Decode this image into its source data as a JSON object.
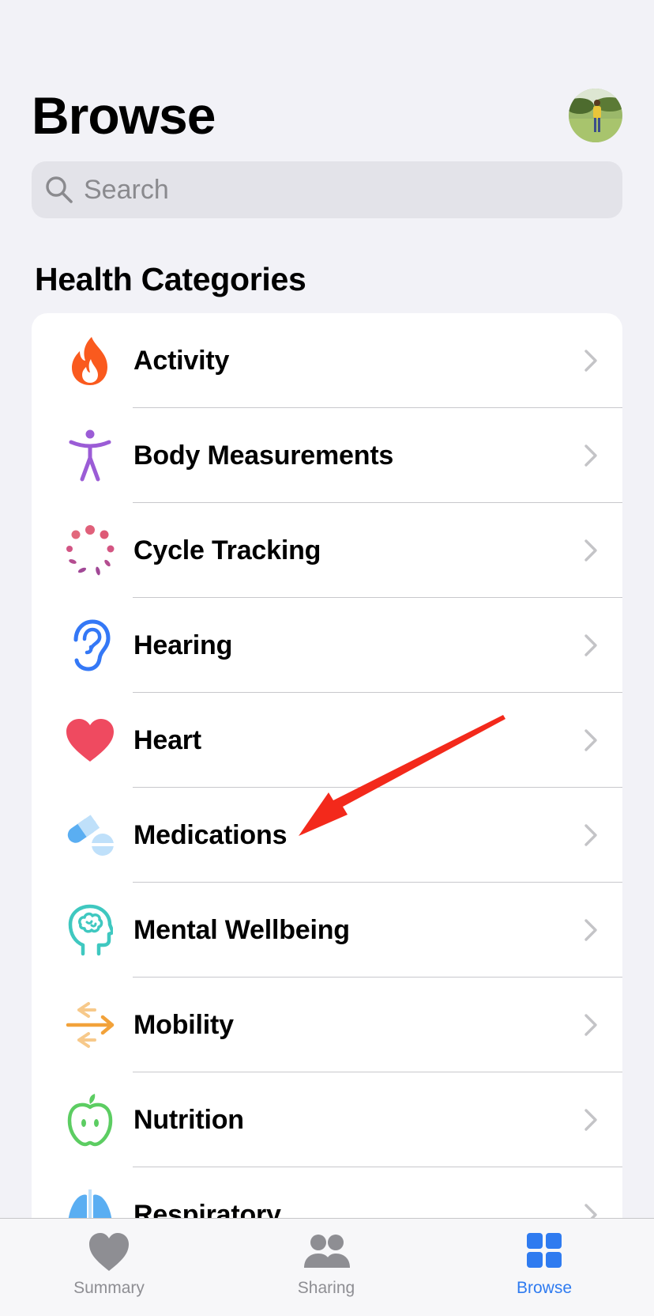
{
  "header": {
    "title": "Browse"
  },
  "search": {
    "placeholder": "Search"
  },
  "section": {
    "title": "Health Categories"
  },
  "categories": [
    {
      "label": "Activity",
      "icon": "flame-icon",
      "color": "#fa5a1e"
    },
    {
      "label": "Body Measurements",
      "icon": "body-figure-icon",
      "color": "#9b5cd6"
    },
    {
      "label": "Cycle Tracking",
      "icon": "cycle-dots-icon",
      "color": "#e0607a"
    },
    {
      "label": "Hearing",
      "icon": "ear-icon",
      "color": "#3478f6"
    },
    {
      "label": "Heart",
      "icon": "heart-icon",
      "color": "#ef4a60"
    },
    {
      "label": "Medications",
      "icon": "pills-icon",
      "color": "#5aaef2"
    },
    {
      "label": "Mental Wellbeing",
      "icon": "head-brain-icon",
      "color": "#3fc8c0"
    },
    {
      "label": "Mobility",
      "icon": "arrows-icon",
      "color": "#f2a23a"
    },
    {
      "label": "Nutrition",
      "icon": "apple-icon",
      "color": "#5ccd62"
    },
    {
      "label": "Respiratory",
      "icon": "lungs-icon",
      "color": "#5aaef2"
    }
  ],
  "tabbar": {
    "tabs": [
      {
        "label": "Summary",
        "icon": "heart-icon",
        "active": false
      },
      {
        "label": "Sharing",
        "icon": "people-icon",
        "active": false
      },
      {
        "label": "Browse",
        "icon": "grid-icon",
        "active": true
      }
    ]
  },
  "colors": {
    "background": "#f2f2f7",
    "accent": "#2f7bf0",
    "annotation_arrow": "#f3291b"
  }
}
